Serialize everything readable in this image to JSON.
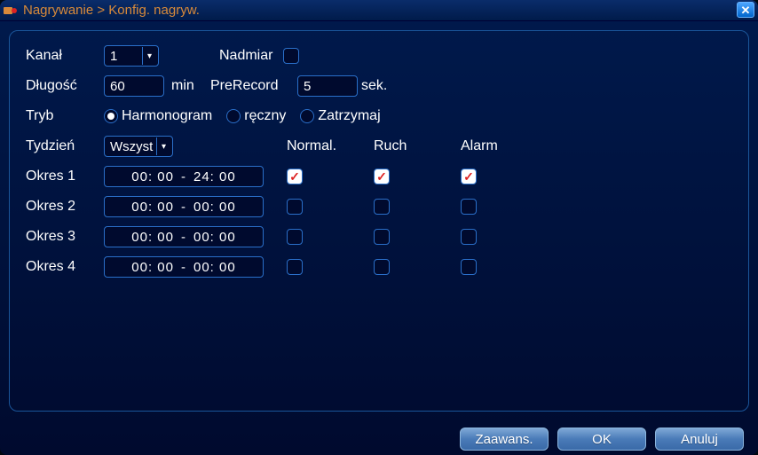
{
  "title": "Nagrywanie > Konfig. nagryw.",
  "labels": {
    "channel": "Kanał",
    "redundancy": "Nadmiar",
    "length": "Długość",
    "min": "min",
    "prerecord": "PreRecord",
    "sec": "sek.",
    "mode": "Tryb",
    "week": "Tydzień",
    "normal": "Normal.",
    "motion": "Ruch",
    "alarm": "Alarm"
  },
  "values": {
    "channel": "1",
    "length": "60",
    "prerecord": "5",
    "week": "Wszyst"
  },
  "modes": {
    "schedule": "Harmonogram",
    "manual": "ręczny",
    "stop": "Zatrzymaj",
    "selected": "schedule"
  },
  "periods": [
    {
      "label": "Okres 1",
      "from": "00:00",
      "to": "24:00",
      "normal": true,
      "motion": true,
      "alarm": true
    },
    {
      "label": "Okres 2",
      "from": "00:00",
      "to": "00:00",
      "normal": false,
      "motion": false,
      "alarm": false
    },
    {
      "label": "Okres 3",
      "from": "00:00",
      "to": "00:00",
      "normal": false,
      "motion": false,
      "alarm": false
    },
    {
      "label": "Okres 4",
      "from": "00:00",
      "to": "00:00",
      "normal": false,
      "motion": false,
      "alarm": false
    }
  ],
  "buttons": {
    "advanced": "Zaawans.",
    "ok": "OK",
    "cancel": "Anuluj"
  },
  "redundancy_checked": false
}
